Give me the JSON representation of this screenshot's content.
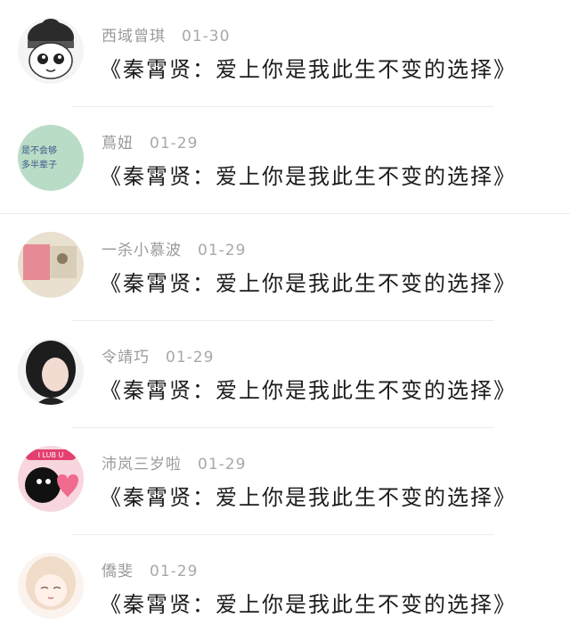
{
  "comments": [
    {
      "user": "西域曾琪",
      "time": "01-30",
      "text": "《秦霄贤：爱上你是我此生不变的选择》",
      "avatar": "cartoon-boy-avatar"
    },
    {
      "user": "蔦妞",
      "time": "01-29",
      "text": "《秦霄贤：爱上你是我此生不变的选择》",
      "avatar": "green-text-avatar"
    },
    {
      "user": "一杀小慕波",
      "time": "01-29",
      "text": "《秦霄贤：爱上你是我此生不变的选择》",
      "avatar": "pink-photo-avatar"
    },
    {
      "user": "令靖巧",
      "time": "01-29",
      "text": "《秦霄贤：爱上你是我此生不变的选择》",
      "avatar": "girl-photo-avatar"
    },
    {
      "user": "沛岚三岁啦",
      "time": "01-29",
      "text": "《秦霄贤：爱上你是我此生不变的选择》",
      "avatar": "pink-heart-avatar"
    },
    {
      "user": "僑斐",
      "time": "01-29",
      "text": "《秦霄贤：爱上你是我此生不变的选择》",
      "avatar": "anime-girl-avatar"
    }
  ],
  "avatar_badges": {
    "heart": "I LUB U",
    "green_line1": "是不会够",
    "green_line2": "多半辈子"
  }
}
